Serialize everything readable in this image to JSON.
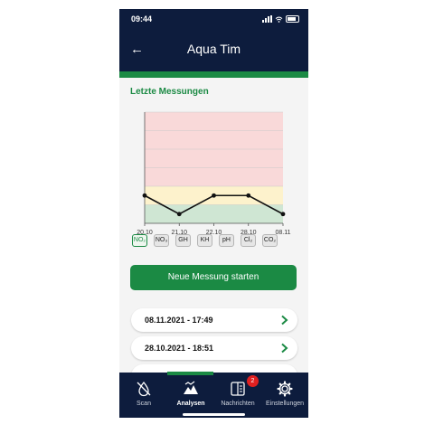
{
  "status": {
    "time": "09:44"
  },
  "header": {
    "title": "Aqua Tim",
    "back_icon": "back-arrow-icon"
  },
  "section": {
    "title": "Letzte Messungen"
  },
  "chart_data": {
    "type": "line",
    "x": [
      "20.10",
      "21.10",
      "22.10",
      "28.10",
      "08.11"
    ],
    "values": [
      1.5,
      0.5,
      1.5,
      1.5,
      0.5
    ],
    "ylim": [
      0,
      6
    ],
    "grid": true,
    "zones": [
      {
        "from": 0,
        "to": 1,
        "color": "#cfe6d3"
      },
      {
        "from": 1,
        "to": 2,
        "color": "#fdf2cc"
      },
      {
        "from": 2,
        "to": 6,
        "color": "#f9d9d9"
      }
    ],
    "line_color": "#111111"
  },
  "parameters": [
    {
      "label": "NO₂",
      "active": true
    },
    {
      "label": "NO₃",
      "active": false
    },
    {
      "label": "GH",
      "active": false
    },
    {
      "label": "KH",
      "active": false
    },
    {
      "label": "pH",
      "active": false
    },
    {
      "label": "Cl₂",
      "active": false
    },
    {
      "label": "CO₂",
      "active": false
    }
  ],
  "actions": {
    "start_label": "Neue Messung starten"
  },
  "measurements": [
    {
      "label": "08.11.2021 - 17:49"
    },
    {
      "label": "28.10.2021 - 18:51"
    }
  ],
  "nav": {
    "items": [
      {
        "label": "Scan",
        "icon": "drop-icon"
      },
      {
        "label": "Analysen",
        "icon": "mountain-chart-icon",
        "active": true
      },
      {
        "label": "Nachrichten",
        "icon": "document-icon",
        "badge": "2"
      },
      {
        "label": "Einstellungen",
        "icon": "gear-icon"
      }
    ]
  },
  "colors": {
    "navy": "#0d1c3d",
    "green": "#1b8a44",
    "badge": "#e02020"
  }
}
